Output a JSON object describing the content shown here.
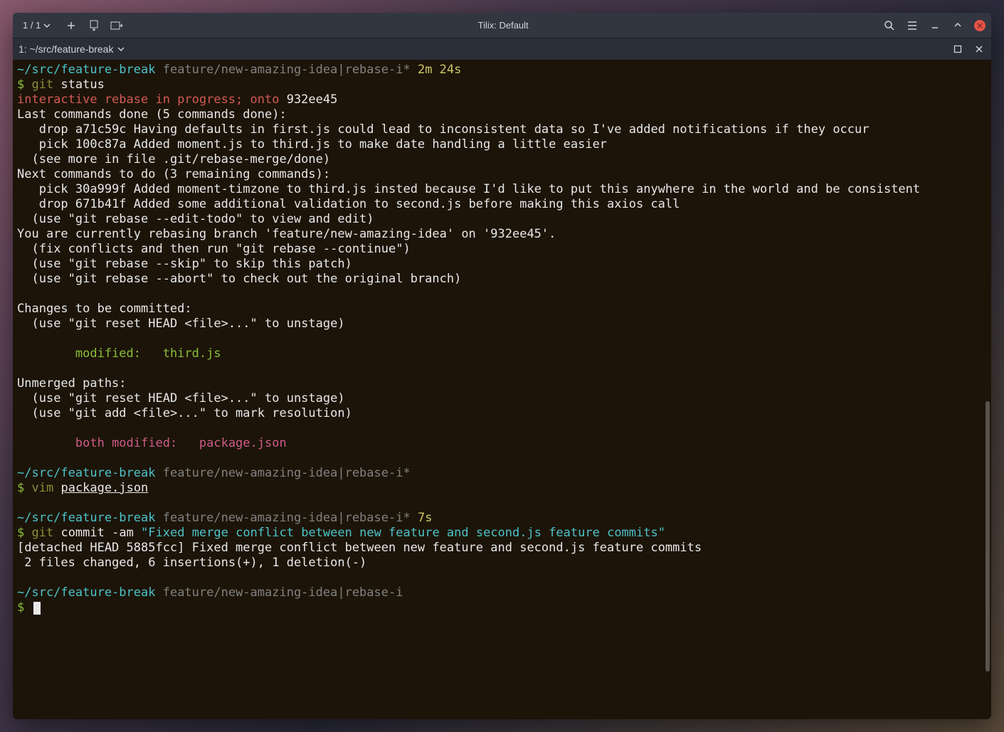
{
  "titlebar": {
    "session": "1 / 1",
    "title": "Tilix: Default"
  },
  "tab": {
    "label": "1: ~/src/feature-break"
  },
  "prompt1": {
    "cwd": "~/src/feature-break",
    "branch": "feature/new-amazing-idea|rebase-i*",
    "time": "2m 24s",
    "ps": "$",
    "cmd_git": "git",
    "cmd_rest": " status"
  },
  "status": {
    "rebase_header": "interactive rebase in progress; onto ",
    "onto_sha": "932ee45",
    "last_done_hdr": "Last commands done (5 commands done):",
    "done1": "   drop a71c59c Having defaults in first.js could lead to inconsistent data so I've added notifications if they occur",
    "done2": "   pick 100c87a Added moment.js to third.js to make date handling a little easier",
    "seemore": "  (see more in file .git/rebase-merge/done)",
    "next_hdr": "Next commands to do (3 remaining commands):",
    "next1": "   pick 30a999f Added moment-timzone to third.js insted because I'd like to put this anywhere in the world and be consistent",
    "next2": "   drop 671b41f Added some additional validation to second.js before making this axios call",
    "edittodo": "  (use \"git rebase --edit-todo\" to view and edit)",
    "currently": "You are currently rebasing branch 'feature/new-amazing-idea' on '932ee45'.",
    "fix": "  (fix conflicts and then run \"git rebase --continue\")",
    "skip": "  (use \"git rebase --skip\" to skip this patch)",
    "abort": "  (use \"git rebase --abort\" to check out the original branch)",
    "changes_hdr": "Changes to be committed:",
    "unstage": "  (use \"git reset HEAD <file>...\" to unstage)",
    "modified": "        modified:   third.js",
    "unmerged_hdr": "Unmerged paths:",
    "unstage2": "  (use \"git reset HEAD <file>...\" to unstage)",
    "markres": "  (use \"git add <file>...\" to mark resolution)",
    "both_mod": "        both modified:   package.json"
  },
  "prompt2": {
    "cwd": "~/src/feature-break",
    "branch": "feature/new-amazing-idea|rebase-i*",
    "ps": "$",
    "cmd_vim": "vim",
    "cmd_file": "package.json"
  },
  "prompt3": {
    "cwd": "~/src/feature-break",
    "branch": "feature/new-amazing-idea|rebase-i*",
    "time": "7s",
    "ps": "$",
    "cmd_git": "git",
    "cmd_rest": " commit -am ",
    "cmd_msg": "\"Fixed merge conflict between new feature and second.js feature commits\""
  },
  "commit_out": {
    "l1": "[detached HEAD 5885fcc] Fixed merge conflict between new feature and second.js feature commits",
    "l2": " 2 files changed, 6 insertions(+), 1 deletion(-)"
  },
  "prompt4": {
    "cwd": "~/src/feature-break",
    "branch": "feature/new-amazing-idea|rebase-i",
    "ps": "$"
  }
}
